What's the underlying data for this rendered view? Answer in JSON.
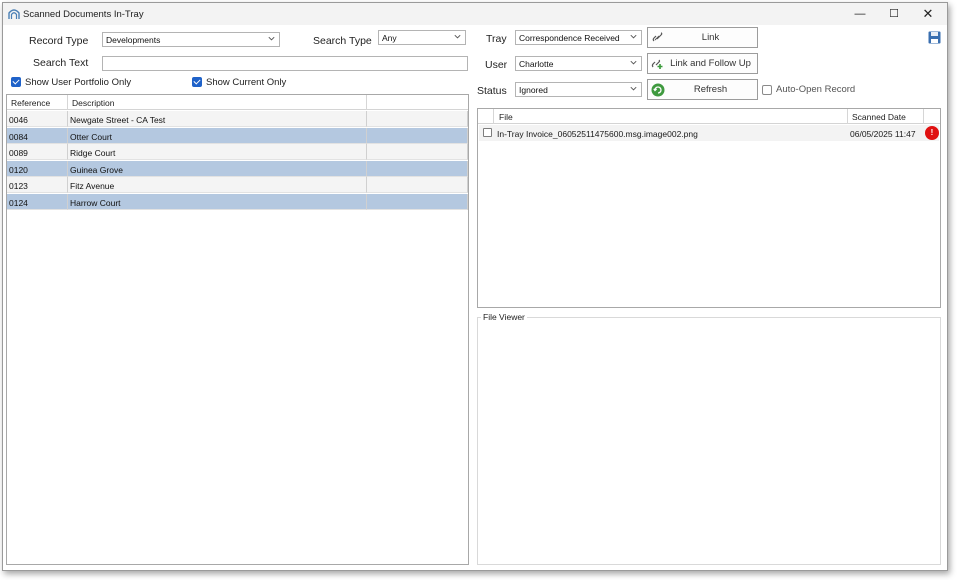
{
  "window": {
    "title": "Scanned Documents In-Tray",
    "controls": {
      "minimize": "—",
      "maximize": "☐",
      "close": "✕"
    }
  },
  "filters": {
    "record_type_label": "Record Type",
    "record_type_value": "Developments",
    "search_type_label": "Search Type",
    "search_type_value": "Any",
    "search_text_label": "Search Text",
    "search_text_value": "",
    "show_user_portfolio_label": "Show User Portfolio Only",
    "show_user_portfolio_checked": true,
    "show_current_only_label": "Show Current Only",
    "show_current_only_checked": true
  },
  "records_grid": {
    "columns": [
      "Reference",
      "Description"
    ],
    "rows": [
      {
        "reference": "0046",
        "description": "Newgate Street - CA Test",
        "highlighted": false
      },
      {
        "reference": "0084",
        "description": "Otter Court",
        "highlighted": true
      },
      {
        "reference": "0089",
        "description": "Ridge Court",
        "highlighted": false
      },
      {
        "reference": "0120",
        "description": "Guinea Grove",
        "highlighted": true
      },
      {
        "reference": "0123",
        "description": "Fitz Avenue",
        "highlighted": false
      },
      {
        "reference": "0124",
        "description": "Harrow Court",
        "highlighted": true
      }
    ]
  },
  "tray_panel": {
    "tray_label": "Tray",
    "tray_value": "Correspondence Received",
    "user_label": "User",
    "user_value": "Charlotte",
    "status_label": "Status",
    "status_value": "Ignored",
    "link_button": "Link",
    "link_follow_up_button": "Link and Follow Up",
    "refresh_button": "Refresh",
    "auto_open_label": "Auto-Open Record",
    "auto_open_checked": false
  },
  "files_grid": {
    "columns": [
      "File",
      "Scanned Date"
    ],
    "rows": [
      {
        "file": "In-Tray Invoice_06052511475600.msg.image002.png",
        "scanned_date": "06/05/2025 11:47",
        "alert": "!"
      }
    ]
  },
  "file_viewer": {
    "label": "File Viewer"
  },
  "colors": {
    "row_highlight": "#b4c8e0",
    "checkbox_accent": "#1f62c9",
    "alert_red": "#e01010",
    "save_icon": "#3a6fb0"
  },
  "icons": [
    "app-arch-icon",
    "chevron-down-icon",
    "save-disk-icon",
    "link-chain-icon",
    "link-follow-up-icon",
    "refresh-icon",
    "alert-icon"
  ]
}
